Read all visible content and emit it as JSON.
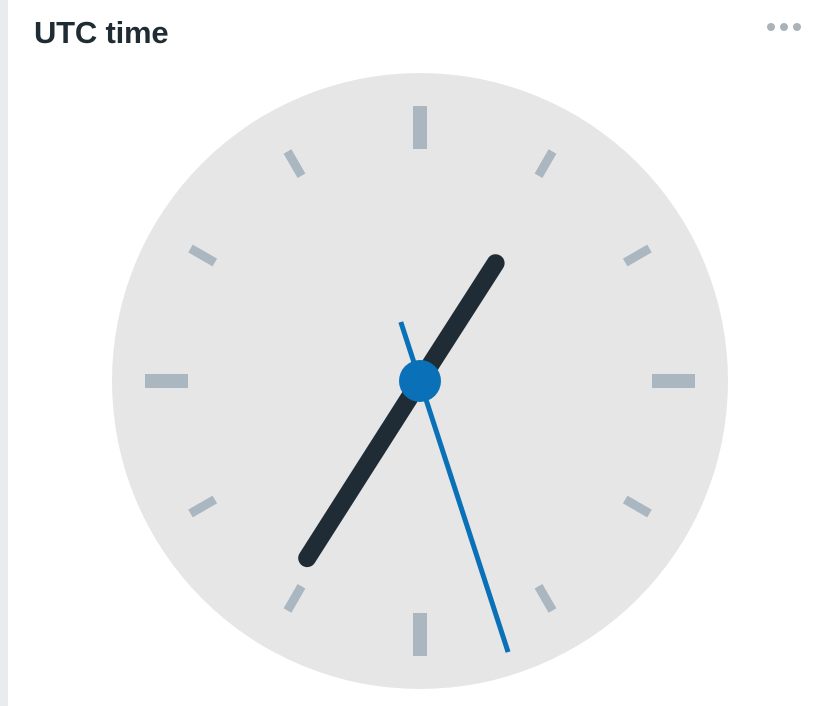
{
  "widget": {
    "title": "UTC time",
    "menu_icon": "more-horizontal-icon"
  },
  "clock": {
    "time": {
      "hour": 7,
      "minute": 5,
      "second": 27
    },
    "colors": {
      "face": "#e6e6e6",
      "tick": "#aab7c1",
      "hour_hand": "#1f2c36",
      "minute_hand": "#1f2c36",
      "second_hand": "#0a71b8",
      "center_dot": "#0a71b8"
    }
  }
}
